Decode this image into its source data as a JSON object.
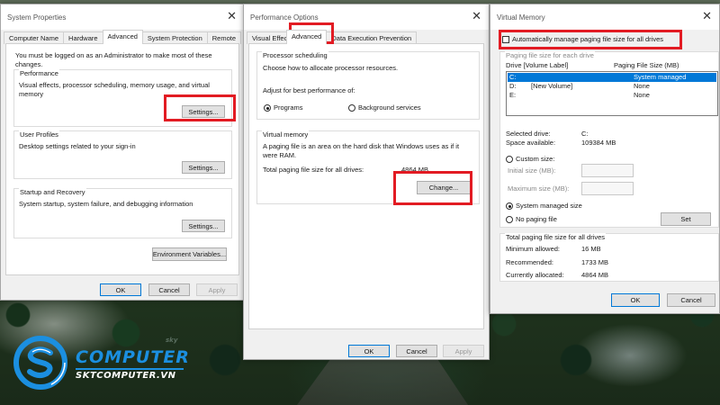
{
  "system_properties": {
    "title": "System Properties",
    "tabs": [
      "Computer Name",
      "Hardware",
      "Advanced",
      "System Protection",
      "Remote"
    ],
    "active_tab": "Advanced",
    "admin_note": "You must be logged on as an Administrator to make most of these changes.",
    "performance": {
      "title": "Performance",
      "description": "Visual effects, processor scheduling, memory usage, and virtual memory",
      "button": "Settings..."
    },
    "user_profiles": {
      "title": "User Profiles",
      "description": "Desktop settings related to your sign-in",
      "button": "Settings..."
    },
    "startup_recovery": {
      "title": "Startup and Recovery",
      "description": "System startup, system failure, and debugging information",
      "button": "Settings..."
    },
    "env_button": "Environment Variables...",
    "ok": "OK",
    "cancel": "Cancel",
    "apply": "Apply"
  },
  "performance_options": {
    "title": "Performance Options",
    "tabs": [
      "Visual Effects",
      "Advanced",
      "Data Execution Prevention"
    ],
    "active_tab": "Advanced",
    "processor": {
      "title": "Processor scheduling",
      "description": "Choose how to allocate processor resources.",
      "adjust_label": "Adjust for best performance of:",
      "programs": "Programs",
      "background": "Background services"
    },
    "virtual_memory": {
      "title": "Virtual memory",
      "description": "A paging file is an area on the hard disk that Windows uses as if it were RAM.",
      "total_label": "Total paging file size for all drives:",
      "total_value": "4864 MB",
      "change_button": "Change..."
    },
    "ok": "OK",
    "cancel": "Cancel",
    "apply": "Apply"
  },
  "virtual_memory": {
    "title": "Virtual Memory",
    "auto_manage": "Automatically manage paging file size for all drives",
    "paging_header": "Paging file size for each drive",
    "columns": {
      "drive": "Drive  [Volume Label]",
      "size": "Paging File Size (MB)"
    },
    "drives": [
      {
        "drive": "C:",
        "label": "",
        "size": "System managed"
      },
      {
        "drive": "D:",
        "label": "[New Volume]",
        "size": "None"
      },
      {
        "drive": "E:",
        "label": "",
        "size": "None"
      }
    ],
    "selected_drive_label": "Selected drive:",
    "selected_drive": "C:",
    "space_available_label": "Space available:",
    "space_available": "109384 MB",
    "custom_size": "Custom size:",
    "initial_size": "Initial size (MB):",
    "maximum_size": "Maximum size (MB):",
    "system_managed": "System managed size",
    "no_paging": "No paging file",
    "set_button": "Set",
    "totals_title": "Total paging file size for all drives",
    "minimum_label": "Minimum allowed:",
    "minimum_value": "16 MB",
    "recommended_label": "Recommended:",
    "recommended_value": "1733 MB",
    "allocated_label": "Currently allocated:",
    "allocated_value": "4864 MB",
    "ok": "OK",
    "cancel": "Cancel"
  },
  "logo": {
    "brand": "COMPUTER",
    "sub": "SKTCOMPUTER.VN",
    "tag": "sky"
  },
  "colors": {
    "highlight": "#e21b23",
    "selection": "#0078d7",
    "logo_blue": "#1b8fe0"
  }
}
